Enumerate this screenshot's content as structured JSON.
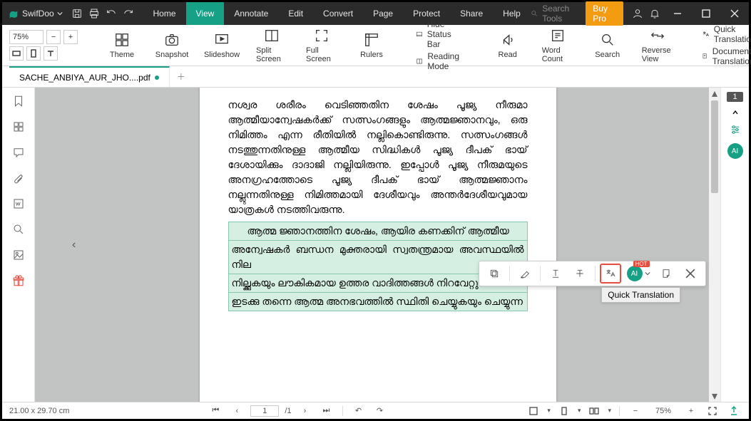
{
  "title": {
    "app": "SwifDoo"
  },
  "menu": [
    "Home",
    "View",
    "Annotate",
    "Edit",
    "Convert",
    "Page",
    "Protect",
    "Share",
    "Help"
  ],
  "activeMenu": 1,
  "searchPlaceholder": "Search Tools",
  "buyPro": "Buy Pro",
  "ribbon": {
    "zoomValue": "75%",
    "theme": "Theme",
    "snapshot": "Snapshot",
    "slideshow": "Slideshow",
    "split": "Split Screen",
    "fullscreen": "Full Screen",
    "rulers": "Rulers",
    "hideStatus": "Hide Status Bar",
    "readingMode": "Reading Mode",
    "read": "Read",
    "wordCount": "Word Count",
    "search": "Search",
    "reverse": "Reverse View",
    "quickTrans": "Quick Translation",
    "docTrans": "Document Translation"
  },
  "tab": {
    "name": "SACHE_ANBIYA_AUR_JHO....pdf"
  },
  "doc": {
    "para": "നശ്വര  ശരീരം  വെടിഞ്ഞതിന  ശേഷം  പൂജ്യ  നീരുമാ ആത്മീയാന്വേഷകർക്ക്  സത്സംഗങ്ങളും  ആത്മജ്ഞാനവും,  ഒരു നിമിത്തം  എന്ന  രീതിയിൽ  നല്ലികൊണ്ടിരുന്നു.    സത്സംഗങ്ങൾ നടത്തുന്നതിനുള്ള  ആത്മീയ  സിദ്ധികൾ  പൂജ്യ  ദീപക്  ഭായ് ദേശായിക്കും ദാദാജി നല്ലിയിരുന്നു.   ഇപ്പോൾ പൂജ്യ നീരുമയുടെ അനഗ്രഹത്തോടെ  പൂജ്യ  ദീപക്  ഭായ്  ആത്മജ്ഞാനം നല്ലുന്നതിനുള്ള  നിമിത്തമായി  ദേശീയവും  അന്തർദേശീയവുമായ യാത്രകൾ നടത്തിവരുന്നു.",
    "h1": "ആത്മ ജ്ഞാനത്തിന ശേഷം, ആയിര കണക്കിന് ആത്മീയ",
    "h2": "അന്വേഷകർ ബന്ധന മുക്തരായി സ്വതന്ത്രമായ അവസ്ഥയിൽ നില",
    "h3": "നില്ക്കുകയും ലൗകികമായ ഉത്തര വാദിത്തങ്ങൾ നിറവേറ്റുന്നതിന്",
    "h4": "ഇടക്കു തന്നെ ആത്മ അനഭവത്തിൽ സ്ഥിതി ചെയ്യുകയും ചെയ്യുന്ന"
  },
  "rightrail": {
    "pagenum": "1",
    "ai": "AI"
  },
  "float": {
    "tooltip": "Quick Translation",
    "ai": "AI",
    "hot": "HOT"
  },
  "status": {
    "dims": "21.00 x 29.70 cm",
    "page": "1",
    "total": "/1",
    "zoom": "75%"
  }
}
